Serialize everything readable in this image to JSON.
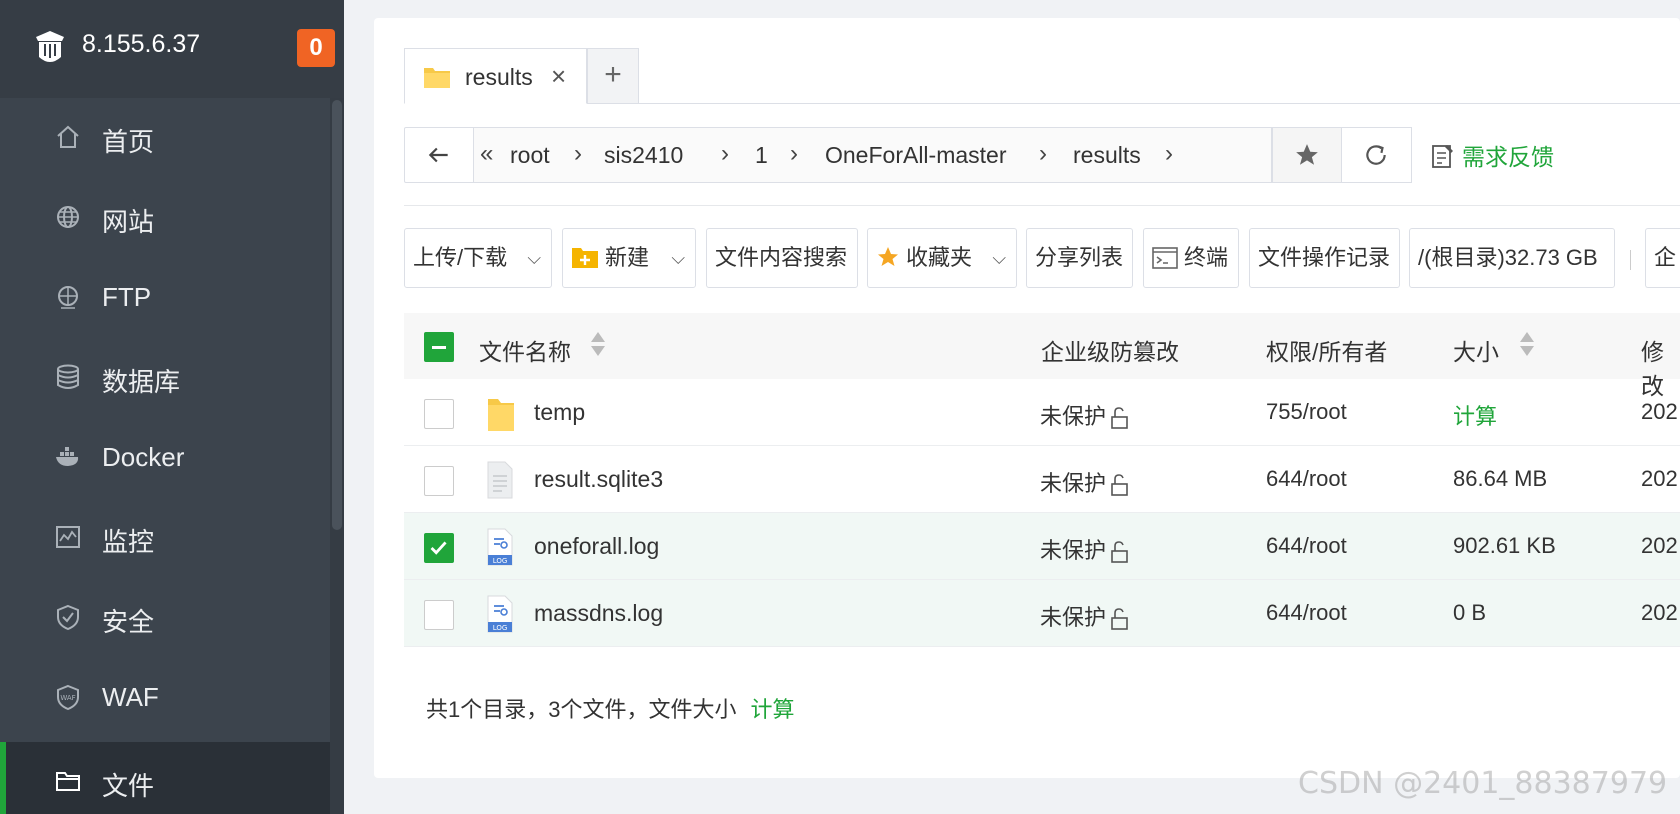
{
  "sidebar": {
    "server_ip": "8.155.6.37",
    "badge_count": "0",
    "items": [
      {
        "label": "首页",
        "icon": "home-icon"
      },
      {
        "label": "网站",
        "icon": "globe-icon"
      },
      {
        "label": "FTP",
        "icon": "ftp-icon"
      },
      {
        "label": "数据库",
        "icon": "database-icon"
      },
      {
        "label": "Docker",
        "icon": "docker-icon"
      },
      {
        "label": "监控",
        "icon": "monitor-icon"
      },
      {
        "label": "安全",
        "icon": "shield-icon"
      },
      {
        "label": "WAF",
        "icon": "waf-icon"
      },
      {
        "label": "文件",
        "icon": "folder-icon",
        "active": true
      }
    ]
  },
  "tabs": [
    {
      "label": "results",
      "close": "×"
    }
  ],
  "tab_add": "+",
  "breadcrumb": [
    "root",
    "sis2410",
    "1",
    "OneForAll-master",
    "results"
  ],
  "feedback_label": "需求反馈",
  "toolbar": {
    "upload": "上传/下载",
    "new": "新建",
    "search": "文件内容搜索",
    "favorites": "收藏夹",
    "share": "分享列表",
    "terminal": "终端",
    "history": "文件操作记录",
    "disk": "/(根目录)32.73 GB",
    "more": "企"
  },
  "table": {
    "headers": {
      "name": "文件名称",
      "protect": "企业级防篡改",
      "perm": "权限/所有者",
      "size": "大小",
      "modified": "修改"
    },
    "rows": [
      {
        "name": "temp",
        "type": "folder",
        "protect": "未保护",
        "perm": "755/root",
        "size": "计算",
        "modified": "202",
        "checked": false
      },
      {
        "name": "result.sqlite3",
        "type": "file",
        "protect": "未保护",
        "perm": "644/root",
        "size": "86.64 MB",
        "modified": "202",
        "checked": false
      },
      {
        "name": "oneforall.log",
        "type": "log",
        "protect": "未保护",
        "perm": "644/root",
        "size": "902.61 KB",
        "modified": "202",
        "checked": true
      },
      {
        "name": "massdns.log",
        "type": "log",
        "protect": "未保护",
        "perm": "644/root",
        "size": "0 B",
        "modified": "202",
        "checked": false
      }
    ]
  },
  "summary": {
    "text": "共1个目录，3个文件，文件大小",
    "calc": "计算"
  },
  "watermark": "CSDN @2401_88387979",
  "colors": {
    "accent": "#20a53a",
    "sidebar_bg": "#3c444d",
    "badge": "#f06424"
  }
}
